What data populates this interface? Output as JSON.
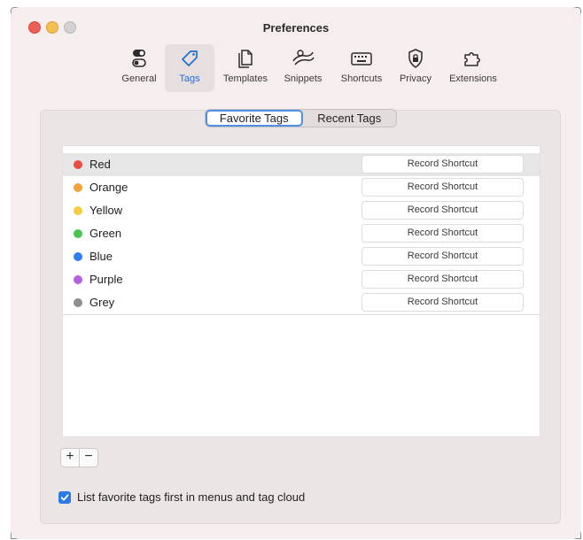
{
  "window": {
    "title": "Preferences"
  },
  "toolbar": {
    "items": [
      {
        "label": "General",
        "icon": "toggles-icon"
      },
      {
        "label": "Tags",
        "icon": "tag-icon",
        "active": true
      },
      {
        "label": "Templates",
        "icon": "documents-icon"
      },
      {
        "label": "Snippets",
        "icon": "snippets-icon"
      },
      {
        "label": "Shortcuts",
        "icon": "keyboard-icon"
      },
      {
        "label": "Privacy",
        "icon": "lock-icon"
      },
      {
        "label": "Extensions",
        "icon": "puzzle-icon"
      }
    ]
  },
  "segmented": {
    "tabs": [
      {
        "label": "Favorite Tags",
        "active": true
      },
      {
        "label": "Recent Tags"
      }
    ]
  },
  "tags": {
    "shortcut_label": "Record Shortcut",
    "rows": [
      {
        "label": "Red",
        "color": "#ec4b45",
        "selected": true
      },
      {
        "label": "Orange",
        "color": "#f3a33b"
      },
      {
        "label": "Yellow",
        "color": "#f6cd3f"
      },
      {
        "label": "Green",
        "color": "#4ac351"
      },
      {
        "label": "Blue",
        "color": "#2f7ef5"
      },
      {
        "label": "Purple",
        "color": "#b45fe0"
      },
      {
        "label": "Grey",
        "color": "#8e8e93"
      }
    ]
  },
  "list_controls": {
    "add": "+",
    "remove": "−"
  },
  "option": {
    "label": "List favorite tags first in menus and tag cloud",
    "checked": true
  }
}
